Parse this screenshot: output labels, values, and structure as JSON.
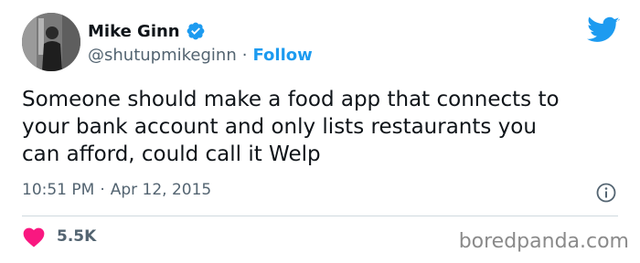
{
  "author": {
    "name": "Mike Ginn",
    "handle": "@shutupmikeginn",
    "separator": "·",
    "follow_label": "Follow"
  },
  "tweet": {
    "text": "Someone should make a food app that connects to\nyour bank account and only lists restaurants you\ncan afford, could call it Welp",
    "time": "10:51 PM",
    "date_separator": "·",
    "date": "Apr 12, 2015"
  },
  "engagement": {
    "likes": "5.5K"
  },
  "watermark": "boredpanda.com",
  "icons": {
    "verified": "verified-badge-icon",
    "bird": "twitter-bird-icon",
    "info": "info-icon",
    "heart": "heart-icon"
  },
  "colors": {
    "brand_blue": "#1d9bf0",
    "heart_pink": "#f91880",
    "secondary_text": "#536471",
    "primary_text": "#0f1419"
  }
}
